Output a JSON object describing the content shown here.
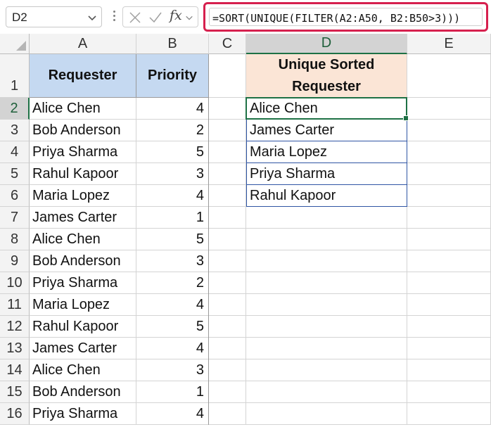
{
  "formula_bar": {
    "name_box": "D2",
    "fx_label": "fx",
    "formula": "=SORT(UNIQUE(FILTER(A2:A50, B2:B50>3)))"
  },
  "columns": [
    "A",
    "B",
    "C",
    "D",
    "E"
  ],
  "rows": [
    "1",
    "2",
    "3",
    "4",
    "5",
    "6",
    "7",
    "8",
    "9",
    "10",
    "11",
    "12",
    "13",
    "14",
    "15",
    "16"
  ],
  "table": {
    "headers": {
      "requester": "Requester",
      "priority": "Priority"
    },
    "data": [
      {
        "requester": "Alice Chen",
        "priority": "4"
      },
      {
        "requester": "Bob Anderson",
        "priority": "2"
      },
      {
        "requester": "Priya Sharma",
        "priority": "5"
      },
      {
        "requester": "Rahul Kapoor",
        "priority": "3"
      },
      {
        "requester": "Maria Lopez",
        "priority": "4"
      },
      {
        "requester": "James Carter",
        "priority": "1"
      },
      {
        "requester": "Alice Chen",
        "priority": "5"
      },
      {
        "requester": "Bob Anderson",
        "priority": "3"
      },
      {
        "requester": "Priya Sharma",
        "priority": "2"
      },
      {
        "requester": "Maria Lopez",
        "priority": "4"
      },
      {
        "requester": "Rahul Kapoor",
        "priority": "5"
      },
      {
        "requester": "James Carter",
        "priority": "4"
      },
      {
        "requester": "Alice Chen",
        "priority": "3"
      },
      {
        "requester": "Bob Anderson",
        "priority": "1"
      },
      {
        "requester": "Priya Sharma",
        "priority": "4"
      }
    ]
  },
  "result": {
    "header": "Unique Sorted Requester",
    "values": [
      "Alice Chen",
      "James Carter",
      "Maria Lopez",
      "Priya Sharma",
      "Rahul Kapoor"
    ]
  },
  "colors": {
    "formula_highlight": "#d6204e",
    "header_blue": "#c5d9f1",
    "header_orange": "#fbe5d6",
    "selection_green": "#1e7145",
    "spill_border": "#2f55a4"
  }
}
